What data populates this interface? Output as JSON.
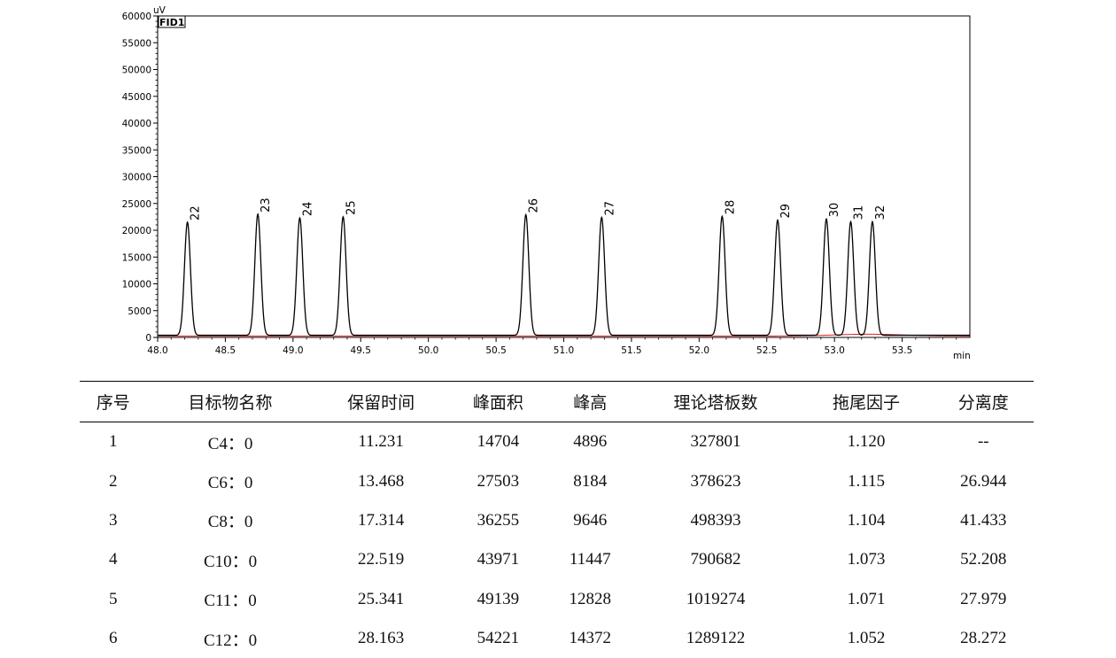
{
  "chart_data": {
    "type": "line",
    "title": "",
    "legend": "FID1",
    "xlabel": "min",
    "ylabel": "uV",
    "xlim": [
      48.0,
      54.0
    ],
    "ylim": [
      0,
      60000
    ],
    "x_ticks": [
      "48.0",
      "48.5",
      "49.0",
      "49.5",
      "50.0",
      "50.5",
      "51.0",
      "51.5",
      "52.0",
      "52.5",
      "53.0",
      "53.5"
    ],
    "y_ticks": [
      "0",
      "5000",
      "10000",
      "15000",
      "20000",
      "25000",
      "30000",
      "35000",
      "40000",
      "45000",
      "50000",
      "55000",
      "60000"
    ],
    "baseline": 400,
    "grid": false,
    "peaks": [
      {
        "label": "22",
        "x": 48.22,
        "y": 21500
      },
      {
        "label": "23",
        "x": 48.74,
        "y": 23000
      },
      {
        "label": "24",
        "x": 49.05,
        "y": 22300
      },
      {
        "label": "25",
        "x": 49.37,
        "y": 22500
      },
      {
        "label": "26",
        "x": 50.72,
        "y": 22900
      },
      {
        "label": "27",
        "x": 51.28,
        "y": 22400
      },
      {
        "label": "28",
        "x": 52.17,
        "y": 22600
      },
      {
        "label": "29",
        "x": 52.58,
        "y": 21900
      },
      {
        "label": "30",
        "x": 52.94,
        "y": 22100
      },
      {
        "label": "31",
        "x": 53.12,
        "y": 21600
      },
      {
        "label": "32",
        "x": 53.28,
        "y": 21600
      }
    ],
    "colors": {
      "signal": "#000000",
      "baseline": "#e02020"
    }
  },
  "table": {
    "headers": [
      "序号",
      "目标物名称",
      "保留时间",
      "峰面积",
      "峰高",
      "理论塔板数",
      "拖尾因子",
      "分离度"
    ],
    "rows": [
      [
        "1",
        "C4：0",
        "11.231",
        "14704",
        "4896",
        "327801",
        "1.120",
        "--"
      ],
      [
        "2",
        "C6：0",
        "13.468",
        "27503",
        "8184",
        "378623",
        "1.115",
        "26.944"
      ],
      [
        "3",
        "C8：0",
        "17.314",
        "36255",
        "9646",
        "498393",
        "1.104",
        "41.433"
      ],
      [
        "4",
        "C10：0",
        "22.519",
        "43971",
        "11447",
        "790682",
        "1.073",
        "52.208"
      ],
      [
        "5",
        "C11：0",
        "25.341",
        "49139",
        "12828",
        "1019274",
        "1.071",
        "27.979"
      ],
      [
        "6",
        "C12：0",
        "28.163",
        "54221",
        "14372",
        "1289122",
        "1.052",
        "28.272"
      ]
    ]
  }
}
